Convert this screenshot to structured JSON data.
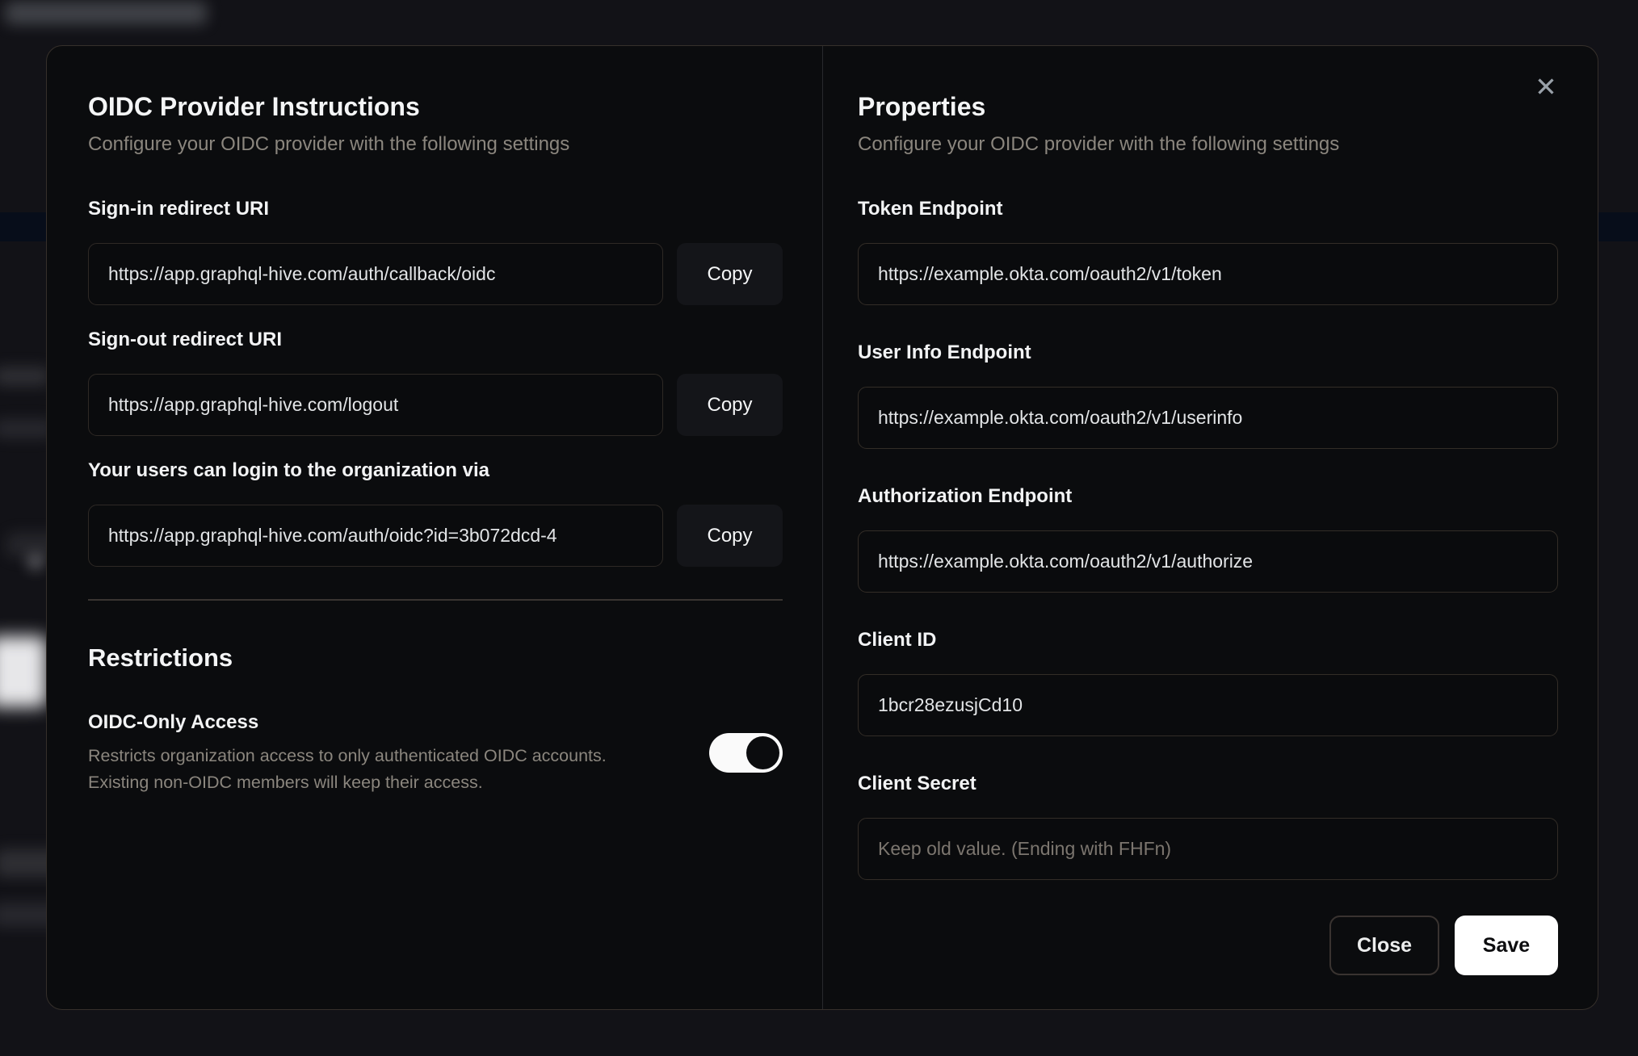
{
  "modal": {
    "close_icon": "✕",
    "left": {
      "title": "OIDC Provider Instructions",
      "subtitle": "Configure your OIDC provider with the following settings",
      "fields": [
        {
          "label": "Sign-in redirect URI",
          "value": "https://app.graphql-hive.com/auth/callback/oidc",
          "copy_label": "Copy"
        },
        {
          "label": "Sign-out redirect URI",
          "value": "https://app.graphql-hive.com/logout",
          "copy_label": "Copy"
        },
        {
          "label": "Your users can login to the organization via",
          "value": "https://app.graphql-hive.com/auth/oidc?id=3b072dcd-4",
          "copy_label": "Copy"
        }
      ],
      "restrictions": {
        "title": "Restrictions",
        "toggle_label": "OIDC-Only Access",
        "description_line1": "Restricts organization access to only authenticated OIDC accounts.",
        "description_line2": "Existing non-OIDC members will keep their access.",
        "toggle_state": "on"
      }
    },
    "right": {
      "title": "Properties",
      "subtitle": "Configure your OIDC provider with the following settings",
      "fields": [
        {
          "label": "Token Endpoint",
          "value": "https://example.okta.com/oauth2/v1/token"
        },
        {
          "label": "User Info Endpoint",
          "value": "https://example.okta.com/oauth2/v1/userinfo"
        },
        {
          "label": "Authorization Endpoint",
          "value": "https://example.okta.com/oauth2/v1/authorize"
        },
        {
          "label": "Client ID",
          "value": "1bcr28ezusjCd10"
        },
        {
          "label": "Client Secret",
          "value": "",
          "placeholder": "Keep old value. (Ending with FHFn)"
        }
      ],
      "buttons": {
        "close": "Close",
        "save": "Save"
      }
    }
  },
  "colors": {
    "modal_background": "#0b0c0e",
    "modal_border": "#36302b",
    "title_text": "#f4f5f6",
    "muted_text": "#8b867e",
    "input_border": "#2e2925",
    "save_button_bg": "#ffffff",
    "save_button_text": "#0d0d0f",
    "toggle_track": "#fafafa",
    "toggle_knob": "#0b0c0e"
  }
}
